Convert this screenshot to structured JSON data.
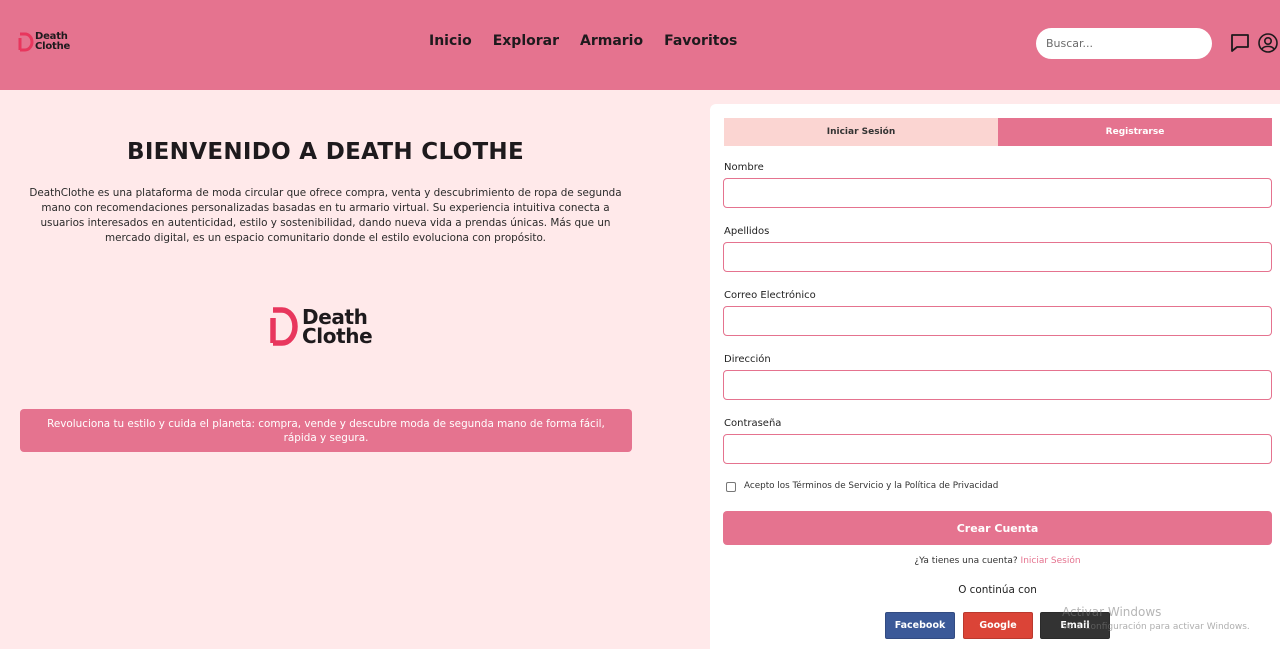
{
  "header": {
    "logo_line1": "Death",
    "logo_line2": "Clothe",
    "nav": [
      "Inicio",
      "Explorar",
      "Armario",
      "Favoritos"
    ],
    "search_placeholder": "Buscar...",
    "icons": [
      "chat-icon",
      "user-icon"
    ]
  },
  "hero": {
    "title": "BIENVENIDO A DEATH CLOTHE",
    "description": "DeathClothe es una plataforma de moda circular que ofrece compra, venta y descubrimiento de ropa de segunda mano con recomendaciones personalizadas basadas en tu armario virtual. Su experiencia intuitiva conecta a usuarios interesados en autenticidad, estilo y sostenibilidad, dando nueva vida a prendas únicas. Más que un mercado digital, es un espacio comunitario donde el estilo evoluciona con propósito.",
    "logo_line1": "Death",
    "logo_line2": "Clothe",
    "banner": "Revoluciona tu estilo y cuida el planeta: compra, vende y descubre moda de segunda mano de forma fácil, rápida y segura."
  },
  "form": {
    "tab_login": "Iniciar Sesión",
    "tab_register": "Registrarse",
    "active_tab": "Registrarse",
    "fields": [
      {
        "label": "Nombre",
        "value": ""
      },
      {
        "label": "Apellidos",
        "value": ""
      },
      {
        "label": "Correo Electrónico",
        "value": ""
      },
      {
        "label": "Dirección",
        "value": ""
      },
      {
        "label": "Contraseña",
        "value": ""
      }
    ],
    "terms_label": "Acepto los Términos de Servicio y la Política de Privacidad",
    "terms_checked": false,
    "submit": "Crear Cuenta",
    "have_account": "¿Ya tienes una cuenta?",
    "login_link": "Iniciar Sesión",
    "continue_with": "O continúa con",
    "social": [
      "Facebook",
      "Google",
      "Email"
    ]
  },
  "watermark": {
    "title": "Activar Windows",
    "subtitle": "Ve a Configuración para activar Windows."
  },
  "colors": {
    "brand_pink": "#e5738f",
    "page_bg": "#ffe9ea",
    "tab_inactive": "#fbd5d2",
    "logo_mark": "#e8365d",
    "facebook": "#3b5998",
    "google": "#db4437",
    "email": "#333333"
  }
}
